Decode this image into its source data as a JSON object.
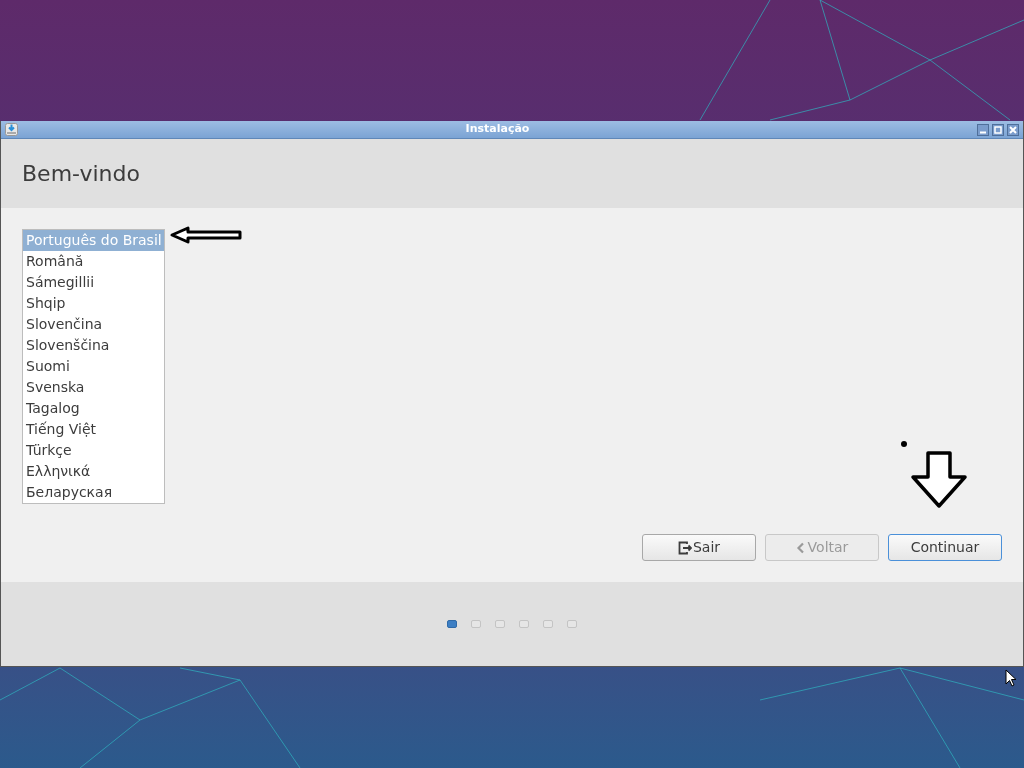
{
  "window": {
    "title": "Instalação"
  },
  "heading": "Bem-vindo",
  "languages": [
    {
      "label": "Português do Brasil",
      "selected": true
    },
    {
      "label": "Română",
      "selected": false
    },
    {
      "label": "Sámegillii",
      "selected": false
    },
    {
      "label": "Shqip",
      "selected": false
    },
    {
      "label": "Slovenčina",
      "selected": false
    },
    {
      "label": "Slovenščina",
      "selected": false
    },
    {
      "label": "Suomi",
      "selected": false
    },
    {
      "label": "Svenska",
      "selected": false
    },
    {
      "label": "Tagalog",
      "selected": false
    },
    {
      "label": "Tiếng Việt",
      "selected": false
    },
    {
      "label": "Türkçe",
      "selected": false
    },
    {
      "label": "Ελληνικά",
      "selected": false
    },
    {
      "label": "Беларуская",
      "selected": false
    }
  ],
  "buttons": [
    {
      "label": "Sair",
      "kind": "quit",
      "disabled": false,
      "focused": false
    },
    {
      "label": "Voltar",
      "kind": "back",
      "disabled": true,
      "focused": false
    },
    {
      "label": "Continuar",
      "kind": "plain",
      "disabled": false,
      "focused": true
    }
  ],
  "steps": [
    {
      "selected": true
    },
    {
      "selected": false
    },
    {
      "selected": false
    },
    {
      "selected": false
    },
    {
      "selected": false
    },
    {
      "selected": false
    }
  ]
}
